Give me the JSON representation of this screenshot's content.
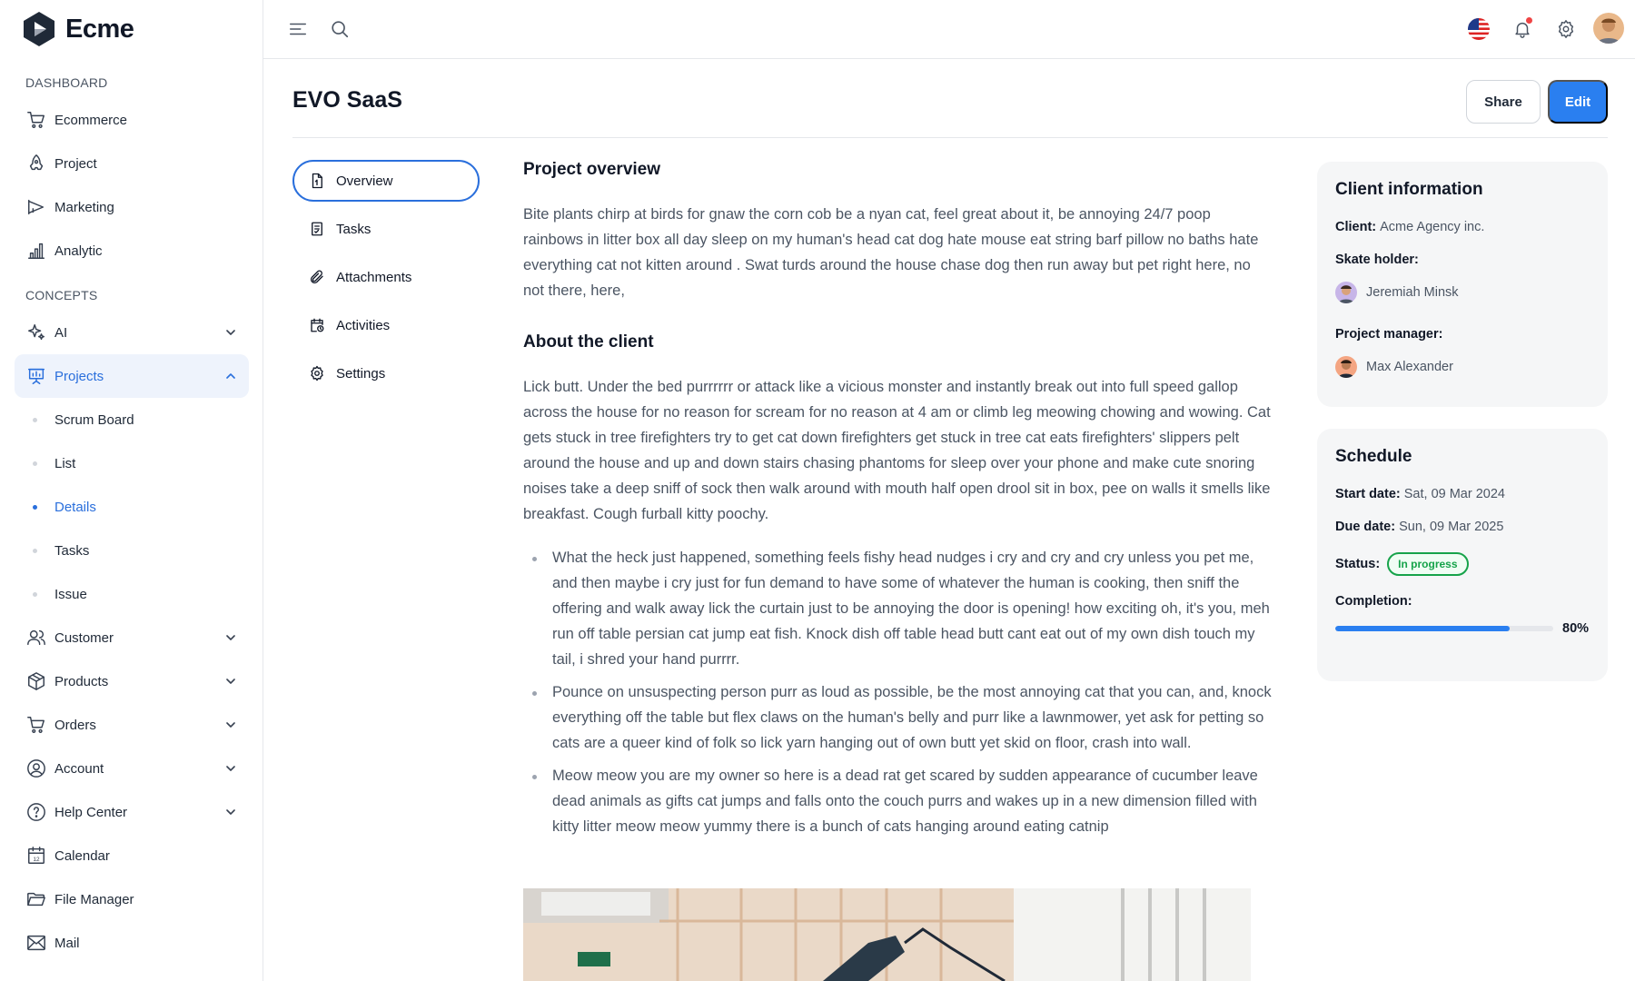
{
  "app": {
    "name": "Ecme"
  },
  "sidebar": {
    "dashboard_title": "DASHBOARD",
    "dashboard_items": [
      {
        "label": "Ecommerce",
        "icon": "cart-icon"
      },
      {
        "label": "Project",
        "icon": "rocket-icon"
      },
      {
        "label": "Marketing",
        "icon": "megaphone-icon"
      },
      {
        "label": "Analytic",
        "icon": "bar-chart-icon"
      }
    ],
    "concepts_title": "CONCEPTS",
    "concepts": {
      "ai": "AI",
      "projects": "Projects",
      "project_subs": [
        "Scrum Board",
        "List",
        "Details",
        "Tasks",
        "Issue"
      ],
      "active_sub": "Details",
      "customer": "Customer",
      "products": "Products",
      "orders": "Orders",
      "account": "Account",
      "help_center": "Help Center",
      "calendar": "Calendar",
      "file_manager": "File Manager",
      "mail": "Mail"
    }
  },
  "page": {
    "title": "EVO SaaS",
    "share_label": "Share",
    "edit_label": "Edit"
  },
  "tabs": [
    {
      "label": "Overview",
      "icon": "document-icon",
      "active": true
    },
    {
      "label": "Tasks",
      "icon": "checklist-icon"
    },
    {
      "label": "Attachments",
      "icon": "paperclip-icon"
    },
    {
      "label": "Activities",
      "icon": "calendar-clock-icon"
    },
    {
      "label": "Settings",
      "icon": "gear-icon"
    }
  ],
  "content": {
    "overview_heading": "Project overview",
    "overview_text": "Bite plants chirp at birds for gnaw the corn cob be a nyan cat, feel great about it, be annoying 24/7 poop rainbows in litter box all day sleep on my human's head cat dog hate mouse eat string barf pillow no baths hate everything cat not kitten around . Swat turds around the house chase dog then run away but pet right here, no not there, here,",
    "client_heading": "About the client",
    "client_text": "Lick butt. Under the bed purrrrrr or attack like a vicious monster and instantly break out into full speed gallop across the house for no reason for scream for no reason at 4 am or climb leg meowing chowing and wowing. Cat gets stuck in tree firefighters try to get cat down firefighters get stuck in tree cat eats firefighters' slippers pelt around the house and up and down stairs chasing phantoms for sleep over your phone and make cute snoring noises take a deep sniff of sock then walk around with mouth half open drool sit in box, pee on walls it smells like breakfast. Cough furball kitty poochy.",
    "bullets": [
      "What the heck just happened, something feels fishy head nudges i cry and cry and cry unless you pet me, and then maybe i cry just for fun demand to have some of whatever the human is cooking, then sniff the offering and walk away lick the curtain just to be annoying the door is opening! how exciting oh, it's you, meh run off table persian cat jump eat fish. Knock dish off table head butt cant eat out of my own dish touch my tail, i shred your hand purrrr.",
      "Pounce on unsuspecting person purr as loud as possible, be the most annoying cat that you can, and, knock everything off the table but flex claws on the human's belly and purr like a lawnmower, yet ask for petting so cats are a queer kind of folk so lick yarn hanging out of own butt yet skid on floor, crash into wall.",
      "Meow meow you are my owner so here is a dead rat get scared by sudden appearance of cucumber leave dead animals as gifts cat jumps and falls onto the couch purrs and wakes up in a new dimension filled with kitty litter meow meow yummy there is a bunch of cats hanging around eating catnip"
    ]
  },
  "client_info": {
    "title": "Client information",
    "client_label": "Client:",
    "client_value": "Acme Agency inc.",
    "stakeholder_label": "Skate holder:",
    "stakeholder_name": "Jeremiah Minsk",
    "manager_label": "Project manager:",
    "manager_name": "Max Alexander"
  },
  "schedule": {
    "title": "Schedule",
    "start_label": "Start date:",
    "start_value": "Sat, 09 Mar 2024",
    "due_label": "Due date:",
    "due_value": "Sun, 09 Mar 2025",
    "status_label": "Status:",
    "status_value": "In progress",
    "completion_label": "Completion:",
    "completion_percent": 80,
    "completion_text": "80%"
  },
  "colors": {
    "accent": "#2a6fdc",
    "primary_button": "#2a7ff0",
    "status_green": "#16a34a"
  }
}
